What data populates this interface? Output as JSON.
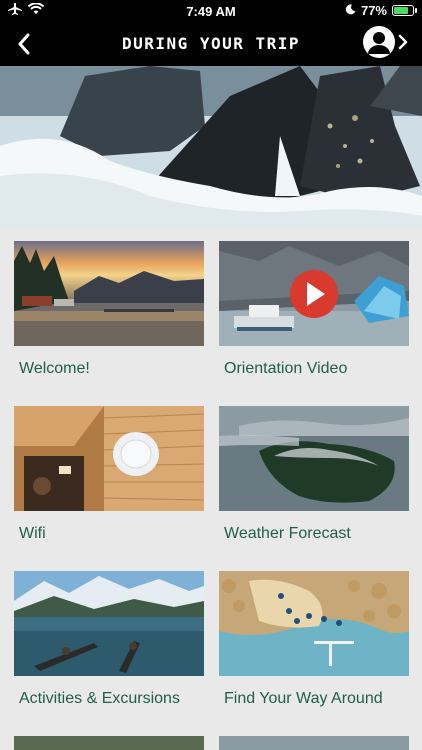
{
  "status_bar": {
    "time": "7:49 AM",
    "battery_percent": "77%",
    "battery_level": 0.77
  },
  "nav": {
    "title": "DURING YOUR TRIP"
  },
  "tiles": [
    {
      "label": "Welcome!"
    },
    {
      "label": "Orientation Video"
    },
    {
      "label": "Wifi"
    },
    {
      "label": "Weather Forecast"
    },
    {
      "label": "Activities & Excursions"
    },
    {
      "label": "Find Your Way Around"
    }
  ],
  "colors": {
    "label_text": "#215e4b",
    "header_bg": "#000000",
    "play_button": "#d93a2e"
  }
}
